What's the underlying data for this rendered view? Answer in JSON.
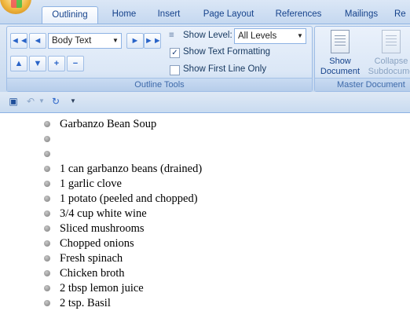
{
  "tabs": [
    "Outlining",
    "Home",
    "Insert",
    "Page Layout",
    "References",
    "Mailings",
    "Re"
  ],
  "active_tab": "Outlining",
  "outline_tools": {
    "level_combo": "Body Text",
    "show_level_label": "Show Level:",
    "show_level_value": "All Levels",
    "show_text_formatting": "Show Text Formatting",
    "show_first_line_only": "Show First Line Only",
    "group_label": "Outline Tools"
  },
  "master_document": {
    "show_document": [
      "Show",
      "Document"
    ],
    "collapse_subdocs": [
      "Collapse",
      "Subdocume"
    ],
    "group_label": "Master Document"
  },
  "items": [
    "Garbanzo Bean Soup",
    "",
    "",
    "1 can garbanzo beans (drained)",
    "1 garlic clove",
    "1 potato (peeled and chopped)",
    "3/4 cup white wine",
    "Sliced mushrooms",
    "Chopped onions",
    "Fresh spinach",
    "Chicken broth",
    "2 tbsp lemon juice",
    "2 tsp. Basil"
  ],
  "icons": {
    "promote_to_heading": "double-left-arrow-icon",
    "promote": "left-arrow-icon",
    "demote": "right-arrow-icon",
    "demote_to_body": "double-right-arrow-icon",
    "move_up": "up-arrow-icon",
    "move_down": "down-arrow-icon",
    "expand": "plus-icon",
    "collapse": "minus-icon"
  }
}
